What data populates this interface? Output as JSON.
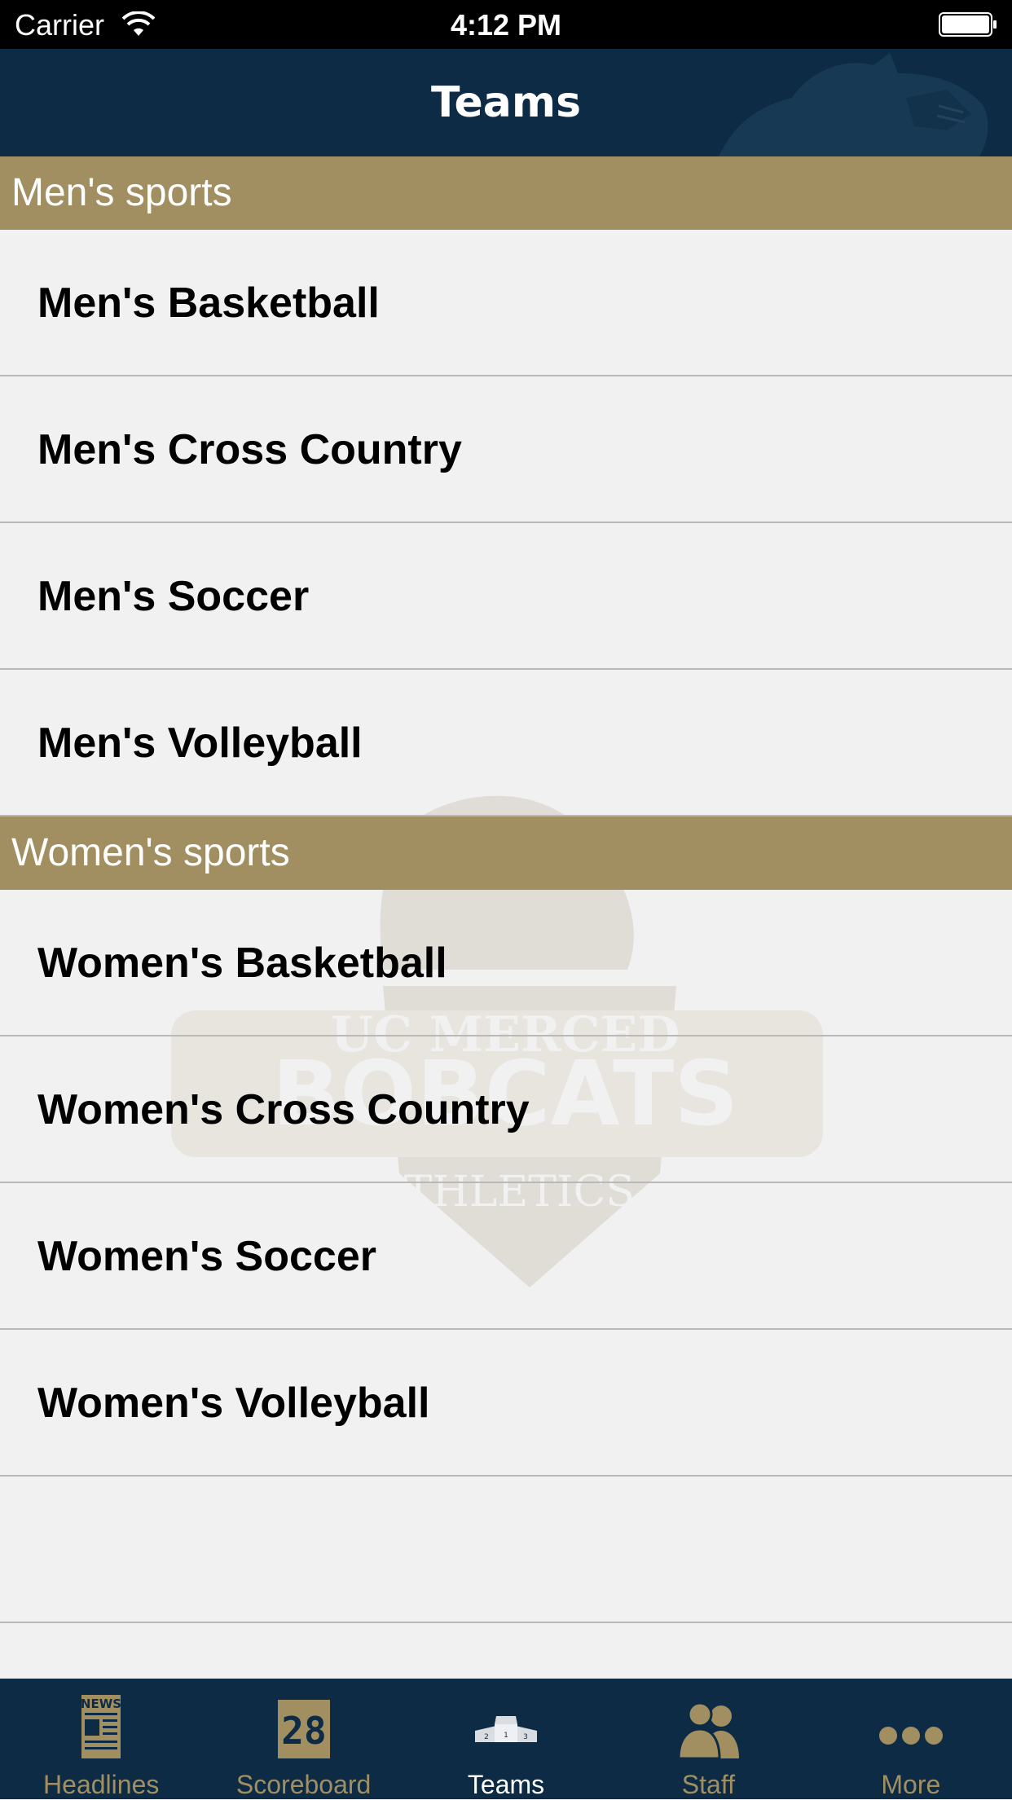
{
  "status_bar": {
    "carrier": "Carrier",
    "time": "4:12 PM"
  },
  "nav": {
    "title": "Teams"
  },
  "sections": [
    {
      "header": "Men's sports",
      "items": [
        "Men's Basketball",
        "Men's Cross Country",
        "Men's Soccer",
        "Men's Volleyball"
      ]
    },
    {
      "header": "Women's sports",
      "items": [
        "Women's Basketball",
        "Women's Cross Country",
        "Women's Soccer",
        "Women's Volleyball"
      ]
    }
  ],
  "watermark": {
    "line1": "UC MERCED",
    "line2": "BOBCATS",
    "line3": "ATHLETICS"
  },
  "tabs": [
    {
      "label": "Headlines",
      "icon": "newspaper-icon",
      "active": false,
      "icon_text": "NEWS"
    },
    {
      "label": "Scoreboard",
      "icon": "scoreboard-icon",
      "active": false,
      "icon_text": "28"
    },
    {
      "label": "Teams",
      "icon": "podium-icon",
      "active": true
    },
    {
      "label": "Staff",
      "icon": "staff-icon",
      "active": false
    },
    {
      "label": "More",
      "icon": "more-dots-icon",
      "active": false
    }
  ],
  "colors": {
    "navy": "#0d2b45",
    "gold": "#a18f62",
    "background": "#f1f1f1"
  }
}
